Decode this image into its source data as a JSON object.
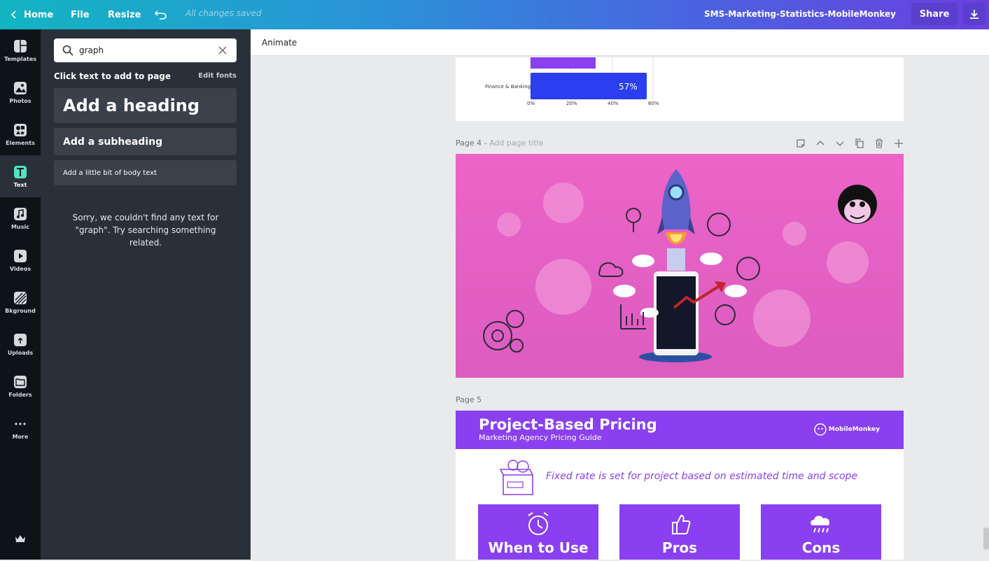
{
  "topbar": {
    "home_label": "Home",
    "file_label": "File",
    "resize_label": "Resize",
    "saved_status": "All changes saved",
    "doc_title": "SMS-Marketing-Statistics-MobileMonkey",
    "share_label": "Share"
  },
  "rail": {
    "items": [
      {
        "label": "Templates"
      },
      {
        "label": "Photos"
      },
      {
        "label": "Elements"
      },
      {
        "label": "Text"
      },
      {
        "label": "Music"
      },
      {
        "label": "Videos"
      },
      {
        "label": "Bkground"
      },
      {
        "label": "Uploads"
      },
      {
        "label": "Folders"
      },
      {
        "label": "More"
      }
    ]
  },
  "panel": {
    "search_value": "graph",
    "header": "Click text to add to page",
    "edit_fonts": "Edit fonts",
    "heading_btn": "Add a heading",
    "subheading_btn": "Add a subheading",
    "body_btn": "Add a little bit of body text",
    "empty_message": "Sorry, we couldn't find any text for \"graph\". Try searching something related."
  },
  "canvas": {
    "animate_label": "Animate",
    "page3": {
      "bar_label": "Finance & Banking",
      "bar_value": "57%",
      "axis_ticks": [
        "0%",
        "20%",
        "40%",
        "60%"
      ]
    },
    "page4": {
      "label": "Page 4 -",
      "title_placeholder": "Add page title"
    },
    "page5": {
      "label": "Page 5",
      "title": "Project-Based Pricing",
      "subtitle": "Marketing Agency Pricing Guide",
      "logo_text": "MobileMonkey",
      "rate_text": "Fixed rate is set for project based on estimated time and scope",
      "cards": [
        {
          "title": "When to Use"
        },
        {
          "title": "Pros"
        },
        {
          "title": "Cons"
        }
      ]
    }
  },
  "colors": {
    "accent_purple": "#8a3ff0",
    "page4_pink": "#e460c4",
    "bar_blue": "#2c3ff0"
  }
}
